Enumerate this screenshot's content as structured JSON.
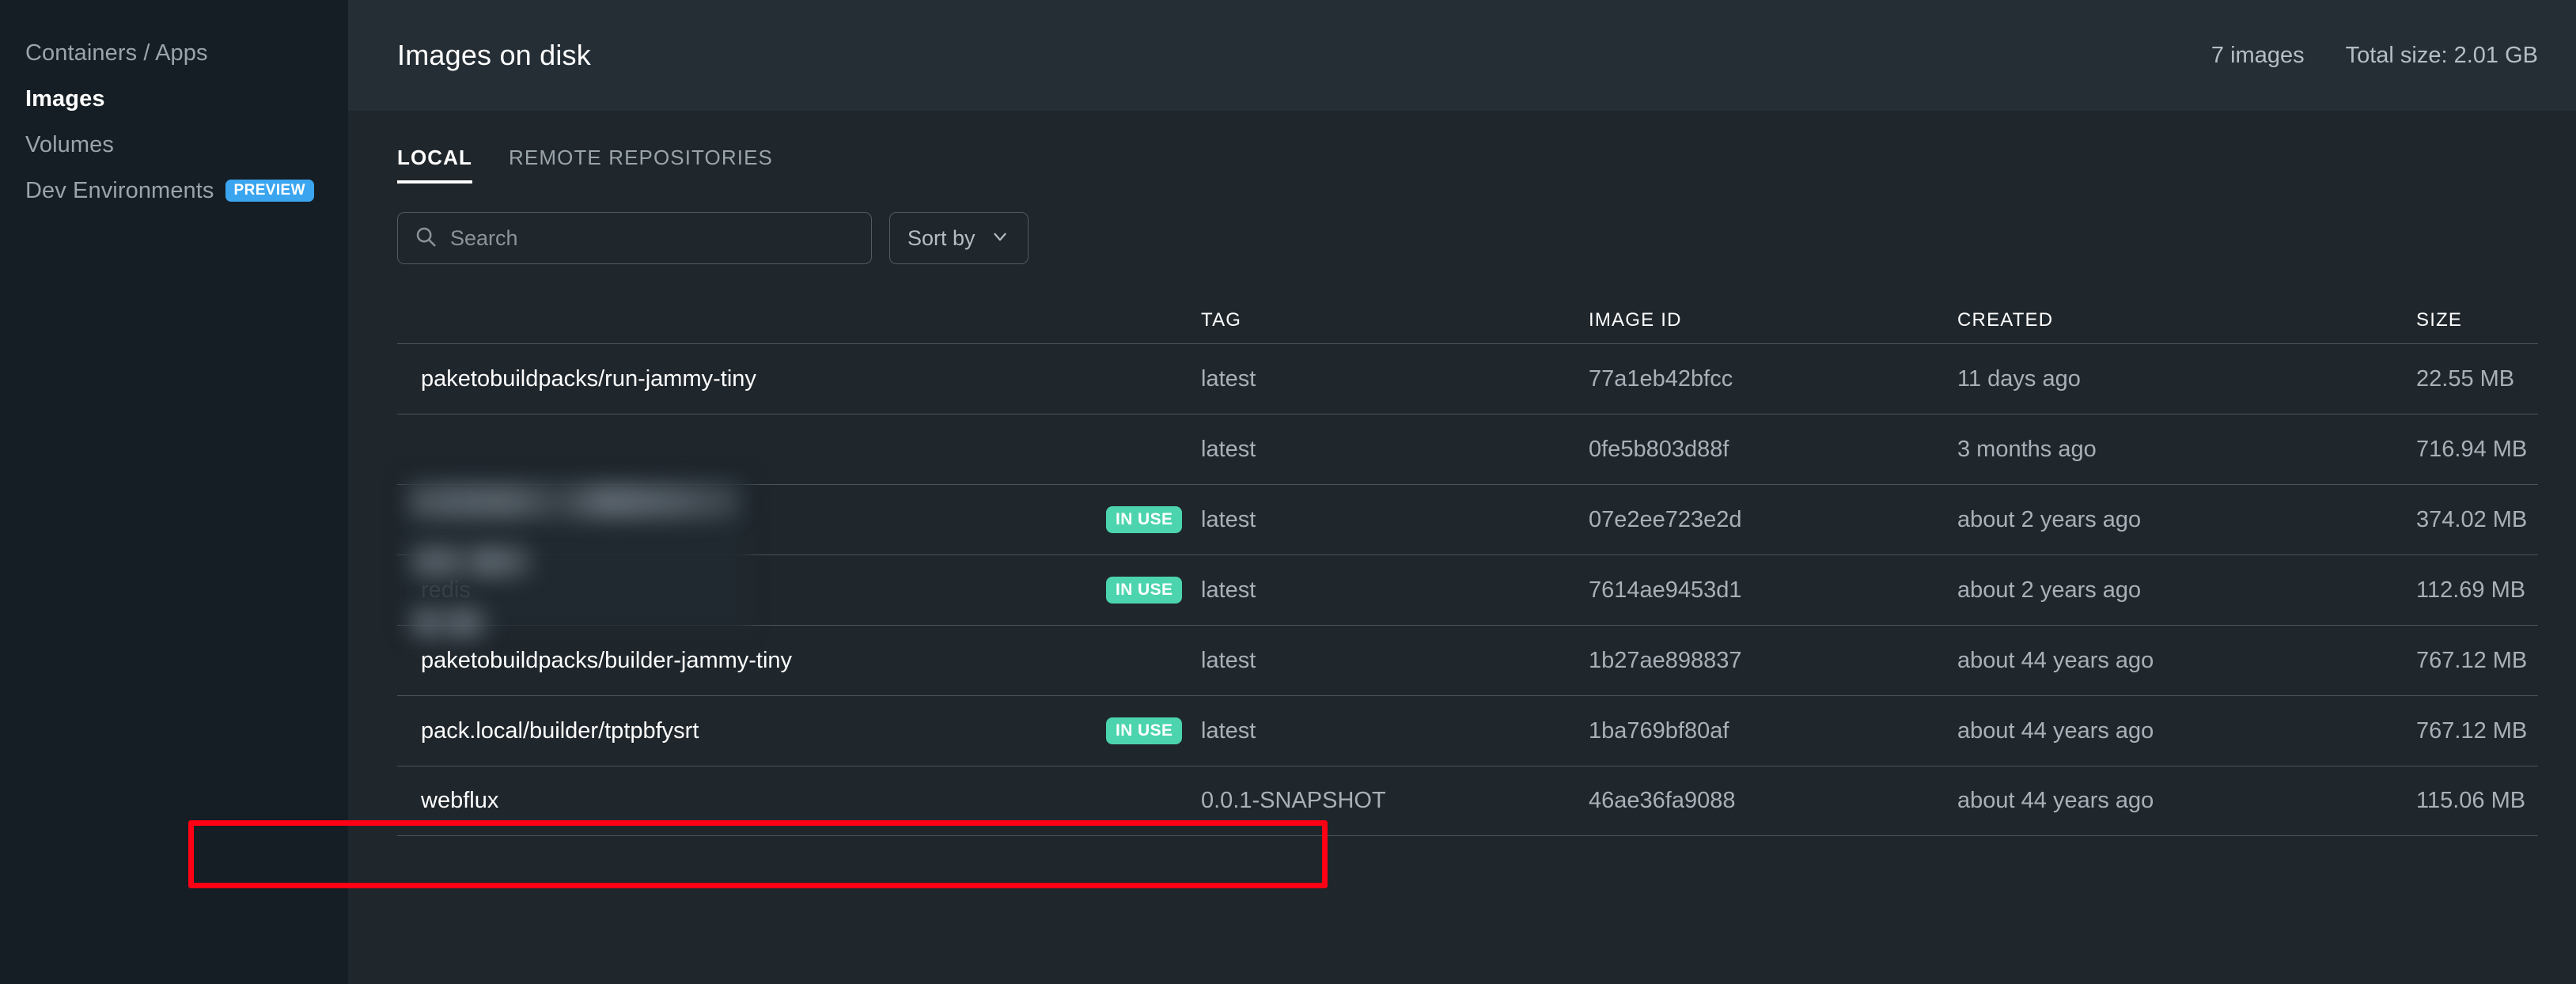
{
  "sidebar": {
    "items": [
      {
        "label": "Containers / Apps",
        "active": false,
        "badge": null
      },
      {
        "label": "Images",
        "active": true,
        "badge": null
      },
      {
        "label": "Volumes",
        "active": false,
        "badge": null
      },
      {
        "label": "Dev Environments",
        "active": false,
        "badge": "PREVIEW"
      }
    ],
    "preview_badge_color": "#3ba5f0"
  },
  "header": {
    "title": "Images on disk",
    "image_count": "7 images",
    "total_size": "Total size: 2.01 GB"
  },
  "tabs": [
    {
      "label": "LOCAL",
      "active": true
    },
    {
      "label": "REMOTE REPOSITORIES",
      "active": false
    }
  ],
  "toolbar": {
    "search_placeholder": "Search",
    "search_value": "",
    "search_icon": "search-icon",
    "sort_label": "Sort by",
    "sort_icon": "chevron-down-icon"
  },
  "table": {
    "columns": [
      "",
      "",
      "TAG",
      "IMAGE ID",
      "CREATED",
      "SIZE"
    ],
    "headers": {
      "name": "",
      "tag": "TAG",
      "image_id": "IMAGE ID",
      "created": "CREATED",
      "size": "SIZE"
    },
    "rows": [
      {
        "name": "paketobuildpacks/run-jammy-tiny",
        "redacted": false,
        "in_use": false,
        "in_use_label": "",
        "tag": "latest",
        "image_id": "77a1eb42bfcc",
        "created": "11 days ago",
        "size": "22.55 MB",
        "highlighted": false
      },
      {
        "name": "",
        "redacted": true,
        "in_use": false,
        "in_use_label": "",
        "tag": "latest",
        "image_id": "0fe5b803d88f",
        "created": "3 months ago",
        "size": "716.94 MB",
        "highlighted": false
      },
      {
        "name": "",
        "redacted": true,
        "in_use": true,
        "in_use_label": "IN USE",
        "tag": "latest",
        "image_id": "07e2ee723e2d",
        "created": "about 2 years ago",
        "size": "374.02 MB",
        "highlighted": false
      },
      {
        "name": "redis",
        "redacted": true,
        "in_use": true,
        "in_use_label": "IN USE",
        "tag": "latest",
        "image_id": "7614ae9453d1",
        "created": "about 2 years ago",
        "size": "112.69 MB",
        "highlighted": false
      },
      {
        "name": "paketobuildpacks/builder-jammy-tiny",
        "redacted": false,
        "in_use": false,
        "in_use_label": "",
        "tag": "latest",
        "image_id": "1b27ae898837",
        "created": "about 44 years ago",
        "size": "767.12 MB",
        "highlighted": false
      },
      {
        "name": "pack.local/builder/tptpbfysrt",
        "redacted": false,
        "in_use": true,
        "in_use_label": "IN USE",
        "tag": "latest",
        "image_id": "1ba769bf80af",
        "created": "about 44 years ago",
        "size": "767.12 MB",
        "highlighted": false
      },
      {
        "name": "webflux",
        "redacted": false,
        "in_use": false,
        "in_use_label": "",
        "tag": "0.0.1-SNAPSHOT",
        "image_id": "46ae36fa9088",
        "created": "about 44 years ago",
        "size": "115.06 MB",
        "highlighted": true
      }
    ]
  },
  "annotation": {
    "highlight_color": "#ff0014",
    "badge_color": "#4cd4ae"
  }
}
